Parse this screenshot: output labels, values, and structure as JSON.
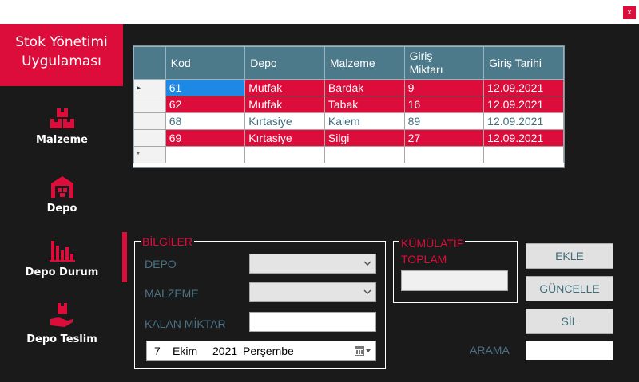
{
  "window": {
    "close_label": "x"
  },
  "brand": {
    "line1": "Stok Yönetimi",
    "line2": "Uygulaması"
  },
  "nav": [
    {
      "label": "Malzeme",
      "icon": "boxes-icon"
    },
    {
      "label": "Depo",
      "icon": "warehouse-icon"
    },
    {
      "label": "Depo Durum",
      "icon": "bar-chart-icon"
    },
    {
      "label": "Depo Teslim",
      "icon": "hand-box-icon"
    }
  ],
  "grid": {
    "columns": [
      "Kod",
      "Depo",
      "Malzeme",
      "Giriş Miktarı",
      "Giriş Tarihi"
    ],
    "column_header_miktar_line1": "Giriş",
    "column_header_miktar_line2": "Miktarı",
    "rows": [
      {
        "kod": "61",
        "depo": "Mutfak",
        "malzeme": "Bardak",
        "miktar": "9",
        "tarih": "12.09.2021",
        "style": "red",
        "current": true
      },
      {
        "kod": "62",
        "depo": "Mutfak",
        "malzeme": "Tabak",
        "miktar": "16",
        "tarih": "12.09.2021",
        "style": "red"
      },
      {
        "kod": "68",
        "depo": "Kırtasiye",
        "malzeme": "Kalem",
        "miktar": "89",
        "tarih": "12.09.2021",
        "style": "white"
      },
      {
        "kod": "69",
        "depo": "Kırtasiye",
        "malzeme": "Silgi",
        "miktar": "27",
        "tarih": "12.09.2021",
        "style": "red"
      }
    ],
    "current_row_marker": "▸",
    "new_row_marker": "*"
  },
  "bilgiler": {
    "title": "BİLGİLER",
    "depo_label": "DEPO",
    "depo_value": "",
    "malzeme_label": "MALZEME",
    "malzeme_value": "",
    "kalan_label": "KALAN MİKTAR",
    "kalan_value": "",
    "date": {
      "day": "7",
      "month": "Ekim",
      "year": "2021",
      "weekday": "Perşembe"
    }
  },
  "kumulatif": {
    "title_line1": "KÜMÜLATİF",
    "title_line2": "TOPLAM",
    "value": ""
  },
  "buttons": {
    "ekle": "EKLE",
    "guncelle": "GÜNCELLE",
    "sil": "SİL"
  },
  "arama": {
    "label": "ARAMA",
    "value": ""
  },
  "colors": {
    "accent": "#dc0d3b",
    "header": "#4d7a8a",
    "label": "#4a7183",
    "background": "#1b1a1a"
  }
}
